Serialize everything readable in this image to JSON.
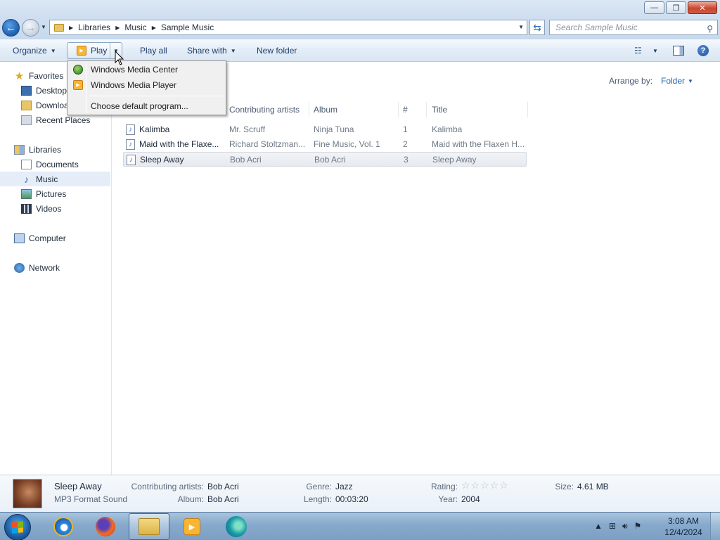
{
  "window": {
    "controls": {
      "minimize": "—",
      "maximize": "❐",
      "close": "✕"
    }
  },
  "address": {
    "crumbs": [
      "Libraries",
      "Music",
      "Sample Music"
    ],
    "search_placeholder": "Search Sample Music"
  },
  "toolbar": {
    "organize": "Organize",
    "play": "Play",
    "play_all": "Play all",
    "share_with": "Share with",
    "new_folder": "New folder"
  },
  "play_menu": {
    "items": [
      "Windows Media Center",
      "Windows Media Player"
    ],
    "default_program": "Choose default program..."
  },
  "sidebar": {
    "favorites": {
      "label": "Favorites",
      "items": [
        "Desktop",
        "Downloads",
        "Recent Places"
      ]
    },
    "libraries": {
      "label": "Libraries",
      "items": [
        "Documents",
        "Music",
        "Pictures",
        "Videos"
      ],
      "selected": "Music"
    },
    "computer": "Computer",
    "network": "Network"
  },
  "arrange": {
    "label": "Arrange by:",
    "value": "Folder"
  },
  "columns": [
    "Contributing artists",
    "Album",
    "#",
    "Title"
  ],
  "files": [
    {
      "name": "Kalimba",
      "artist": "Mr. Scruff",
      "album": "Ninja Tuna",
      "track": "1",
      "title": "Kalimba"
    },
    {
      "name": "Maid with the Flaxe...",
      "artist": "Richard Stoltzman...",
      "album": "Fine Music, Vol. 1",
      "track": "2",
      "title": "Maid with the Flaxen H..."
    },
    {
      "name": "Sleep Away",
      "artist": "Bob Acri",
      "album": "Bob Acri",
      "track": "3",
      "title": "Sleep Away"
    }
  ],
  "selected_file_index": 2,
  "details": {
    "name": "Sleep Away",
    "type": "MP3 Format Sound",
    "contributing_artists_label": "Contributing artists:",
    "contributing_artists": "Bob Acri",
    "album_label": "Album:",
    "album": "Bob Acri",
    "genre_label": "Genre:",
    "genre": "Jazz",
    "length_label": "Length:",
    "length": "00:03:20",
    "rating_label": "Rating:",
    "rating_stars": 0,
    "year_label": "Year:",
    "year": "2004",
    "size_label": "Size:",
    "size": "4.61 MB"
  },
  "taskbar": {
    "apps": [
      "internet-explorer",
      "firefox",
      "windows-explorer",
      "windows-media-player",
      "edge"
    ],
    "active_app": "windows-explorer",
    "time": "3:08 AM",
    "date": "12/4/2024"
  }
}
